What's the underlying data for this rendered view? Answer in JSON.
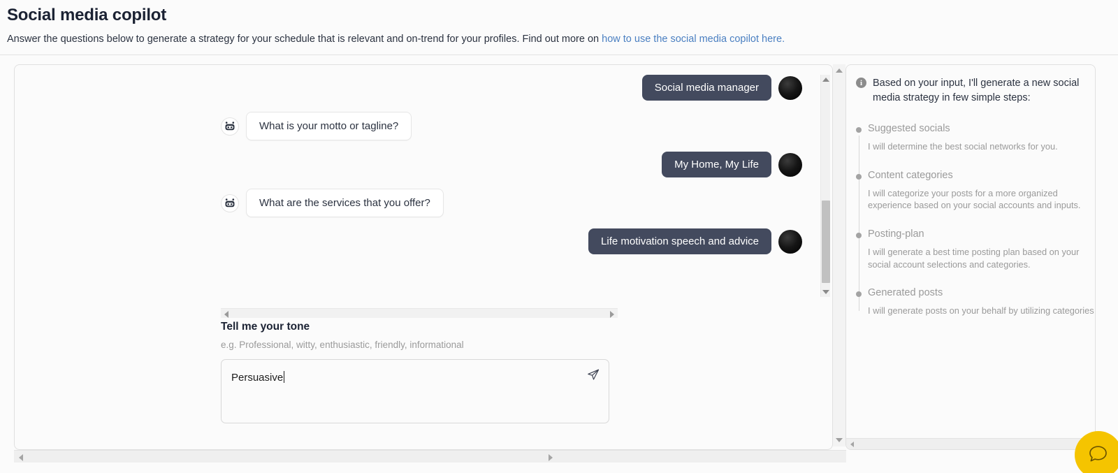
{
  "header": {
    "title": "Social media copilot",
    "subtitle_before": "Answer the questions below to generate a strategy for your schedule that is relevant and on-trend for your profiles. Find out more on ",
    "subtitle_link": "how to use the social media copilot here."
  },
  "chat": {
    "messages": [
      {
        "role": "user",
        "text": "Social media manager"
      },
      {
        "role": "bot",
        "text": "What is your motto or tagline?"
      },
      {
        "role": "user",
        "text": "My Home, My Life"
      },
      {
        "role": "bot",
        "text": "What are the services that you offer?"
      },
      {
        "role": "user",
        "text": "Life motivation speech and advice"
      }
    ],
    "bot_avatar_icon": "robot-icon",
    "user_avatar_icon": "user-photo-avatar"
  },
  "prompt": {
    "label": "Tell me your tone",
    "hint": "e.g. Professional, witty, enthusiastic, friendly, informational",
    "value": "Persuasive",
    "placeholder": "",
    "send_icon": "send-paper-plane-icon"
  },
  "steps_panel": {
    "info_icon_glyph": "i",
    "intro": "Based on your input, I'll generate a new social media strategy in few simple steps:",
    "steps": [
      {
        "title": "Suggested socials",
        "desc": "I will determine the best social networks for you."
      },
      {
        "title": "Content categories",
        "desc": "I will categorize your posts for a more organized experience based on your social accounts and inputs."
      },
      {
        "title": "Posting-plan",
        "desc": "I will generate a best time posting plan based on your social account selections and categories."
      },
      {
        "title": "Generated posts",
        "desc": "I will generate posts on your behalf by utilizing categories and considering your selected so"
      }
    ]
  },
  "widget": {
    "icon": "chat-bubble-icon",
    "color": "#f5c400"
  },
  "colors": {
    "user_bubble": "#434a5e",
    "link": "#4a7fc1",
    "muted_text": "#9a9a9a",
    "heading": "#1b2233"
  }
}
